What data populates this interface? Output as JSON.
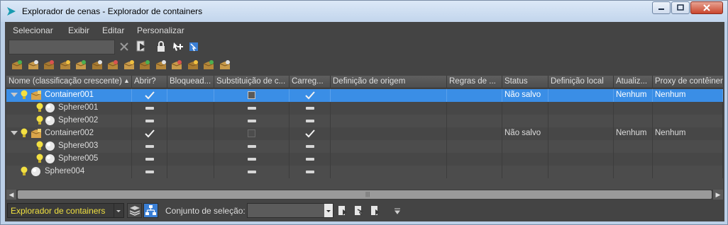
{
  "window": {
    "title": "Explorador de cenas - Explorador de containers",
    "colors": {
      "client_bg": "#444444",
      "selection": "#3a8ee6",
      "accent_yellow": "#f0e040"
    }
  },
  "menu": {
    "items": [
      "Selecionar",
      "Exibir",
      "Editar",
      "Personalizar"
    ]
  },
  "toolbar": {
    "search_value": "",
    "row1_icons": [
      "clear-search-icon",
      "find-icon",
      "lock-icon",
      "select-children-icon",
      "select-dependents-icon"
    ],
    "row2_icons": [
      "container-create-icon",
      "container-add-icon",
      "container-inherit-icon",
      "container-merge-icon",
      "container-open-icon",
      "container-close-icon",
      "container-edit-icon",
      "container-save-icon",
      "container-update-icon",
      "container-reload-icon",
      "container-unload-icon",
      "container-proxy-icon",
      "container-lock-icon",
      "container-settings-icon"
    ]
  },
  "grid": {
    "columns": [
      "Nome (classificação crescente)",
      "Abrir?",
      "Bloquead...",
      "Substituição de c...",
      "Carreg...",
      "Definição de origem",
      "Regras de ...",
      "Status",
      "Definição local",
      "Atualiz...",
      "Proxy de contêiner"
    ],
    "sort_indicator": "▲",
    "rows": [
      {
        "name": "Container001",
        "level": 0,
        "expanded": true,
        "type": "container",
        "abrir": "check",
        "substituicao": "box",
        "carregado": "check",
        "status": "Não salvo",
        "atualiz": "Nenhum",
        "proxy": "Nenhum",
        "selected": true
      },
      {
        "name": "Sphere001",
        "level": 1,
        "type": "sphere",
        "abrir": "dash",
        "substituicao": "dash",
        "carregado": "dash",
        "status": "",
        "atualiz": "",
        "proxy": "",
        "selected": false
      },
      {
        "name": "Sphere002",
        "level": 1,
        "type": "sphere",
        "abrir": "dash",
        "substituicao": "dash",
        "carregado": "dash",
        "status": "",
        "atualiz": "",
        "proxy": "",
        "selected": false
      },
      {
        "name": "Container002",
        "level": 0,
        "expanded": true,
        "type": "container",
        "abrir": "check",
        "substituicao": "box-dim",
        "carregado": "check",
        "status": "Não salvo",
        "atualiz": "Nenhum",
        "proxy": "Nenhum",
        "selected": false
      },
      {
        "name": "Sphere003",
        "level": 1,
        "type": "sphere",
        "abrir": "dash",
        "substituicao": "dash",
        "carregado": "dash",
        "status": "",
        "atualiz": "",
        "proxy": "",
        "selected": false
      },
      {
        "name": "Sphere005",
        "level": 1,
        "type": "sphere",
        "abrir": "dash",
        "substituicao": "dash",
        "carregado": "dash",
        "status": "",
        "atualiz": "",
        "proxy": "",
        "selected": false
      },
      {
        "name": "Sphere004",
        "level": 0,
        "type": "sphere",
        "abrir": "dash",
        "substituicao": "dash",
        "carregado": "dash",
        "status": "",
        "atualiz": "",
        "proxy": "",
        "selected": false
      }
    ]
  },
  "bottom": {
    "explorer_value": "Explorador de containers",
    "selection_set_label": "Conjunto de seleção:",
    "selection_set_value": ""
  }
}
